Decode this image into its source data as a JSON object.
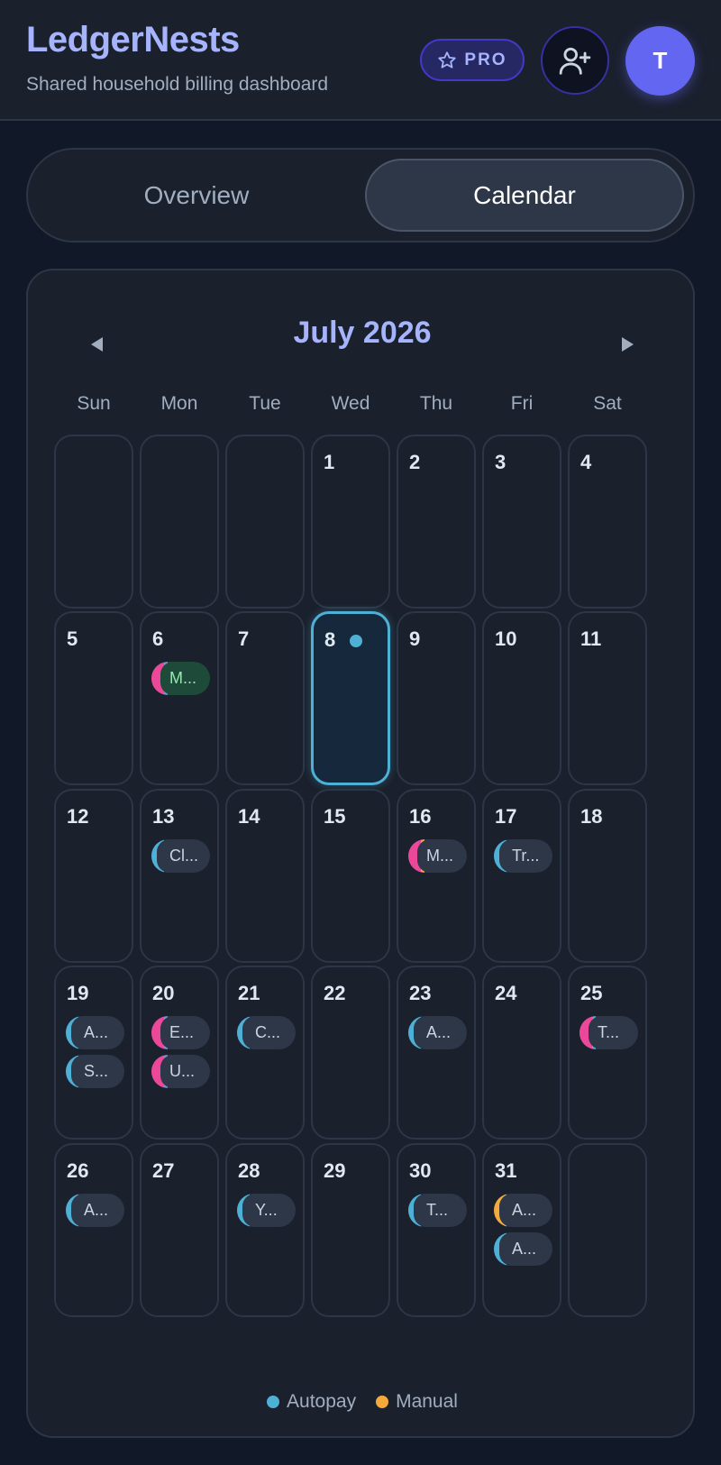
{
  "header": {
    "title": "LedgerNests",
    "subtitle": "Shared household billing dashboard",
    "pro_label": "PRO",
    "avatar_initial": "T"
  },
  "tabs": [
    {
      "label": "Overview",
      "active": false
    },
    {
      "label": "Calendar",
      "active": true
    }
  ],
  "calendar": {
    "month_label": "July 2026",
    "weekdays": [
      "Sun",
      "Mon",
      "Tue",
      "Wed",
      "Thu",
      "Fri",
      "Sat"
    ],
    "today": 8,
    "weeks": [
      [
        {
          "day": ""
        },
        {
          "day": ""
        },
        {
          "day": ""
        },
        {
          "day": "1"
        },
        {
          "day": "2"
        },
        {
          "day": "3"
        },
        {
          "day": "4"
        }
      ],
      [
        {
          "day": "5"
        },
        {
          "day": "6",
          "events": [
            {
              "label": "M...",
              "marks": [
                "#ec4899",
                "#8b8ad8"
              ],
              "paid": true
            }
          ]
        },
        {
          "day": "7"
        },
        {
          "day": "8"
        },
        {
          "day": "9"
        },
        {
          "day": "10"
        },
        {
          "day": "11"
        }
      ],
      [
        {
          "day": "12"
        },
        {
          "day": "13",
          "events": [
            {
              "label": "Cl...",
              "marks": [
                "#4fb0d6"
              ]
            }
          ]
        },
        {
          "day": "14"
        },
        {
          "day": "15"
        },
        {
          "day": "16",
          "events": [
            {
              "label": "M...",
              "marks": [
                "#ec4899",
                "#f6a93b"
              ]
            }
          ]
        },
        {
          "day": "17",
          "events": [
            {
              "label": "Tr...",
              "marks": [
                "#4fb0d6"
              ]
            }
          ]
        },
        {
          "day": "18"
        }
      ],
      [
        {
          "day": "19",
          "events": [
            {
              "label": "A...",
              "marks": [
                "#4fb0d6"
              ]
            },
            {
              "label": "S...",
              "marks": [
                "#4fb0d6"
              ]
            }
          ]
        },
        {
          "day": "20",
          "events": [
            {
              "label": "E...",
              "marks": [
                "#ec4899",
                "#8b8ad8"
              ]
            },
            {
              "label": "U...",
              "marks": [
                "#ec4899",
                "#8b8ad8"
              ]
            }
          ]
        },
        {
          "day": "21",
          "events": [
            {
              "label": "C...",
              "marks": [
                "#4fb0d6"
              ]
            }
          ]
        },
        {
          "day": "22"
        },
        {
          "day": "23",
          "events": [
            {
              "label": "A...",
              "marks": [
                "#4fb0d6"
              ]
            }
          ]
        },
        {
          "day": "24"
        },
        {
          "day": "25",
          "events": [
            {
              "label": "T...",
              "marks": [
                "#ec4899",
                "#4fb0d6"
              ]
            }
          ]
        }
      ],
      [
        {
          "day": "26",
          "events": [
            {
              "label": "A...",
              "marks": [
                "#4fb0d6"
              ]
            }
          ]
        },
        {
          "day": "27"
        },
        {
          "day": "28",
          "events": [
            {
              "label": "Y...",
              "marks": [
                "#4fb0d6"
              ]
            }
          ]
        },
        {
          "day": "29"
        },
        {
          "day": "30",
          "events": [
            {
              "label": "T...",
              "marks": [
                "#4fb0d6"
              ]
            }
          ]
        },
        {
          "day": "31",
          "events": [
            {
              "label": "A...",
              "marks": [
                "#f6a93b"
              ]
            },
            {
              "label": "A...",
              "marks": [
                "#4fb0d6"
              ]
            }
          ]
        },
        {
          "day": ""
        }
      ]
    ]
  },
  "legend": [
    {
      "label": "Autopay",
      "color": "#4fb0d6"
    },
    {
      "label": "Manual",
      "color": "#f6a93b"
    }
  ],
  "icons": {
    "pro": "star-icon",
    "invite": "user-plus-icon",
    "prev": "triangle-left-icon",
    "next": "triangle-right-icon"
  }
}
